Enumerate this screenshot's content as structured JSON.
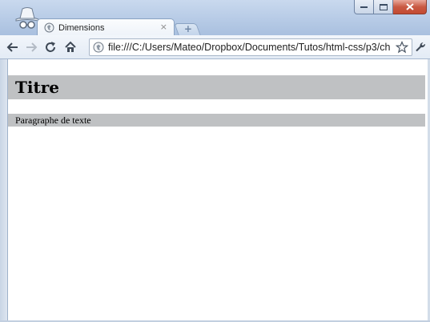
{
  "browser": {
    "tab": {
      "title": "Dimensions",
      "close_symbol": "×"
    },
    "new_tab_symbol": "+",
    "address": {
      "url": "file:///C:/Users/Mateo/Dropbox/Documents/Tutos/html-css/p3/ch"
    },
    "icons": {
      "incognito": "incognito-icon",
      "back": "back-arrow-icon",
      "forward": "forward-arrow-icon",
      "reload": "reload-icon",
      "home": "home-icon",
      "page": "globe-icon",
      "bookmark": "star-icon",
      "menu": "wrench-icon"
    },
    "colors": {
      "frame": "#b7cbe6",
      "close_button": "#c95a43"
    }
  },
  "page": {
    "heading": "Titre",
    "paragraph": "Paragraphe de texte",
    "block_background": "#bfc1c3"
  }
}
